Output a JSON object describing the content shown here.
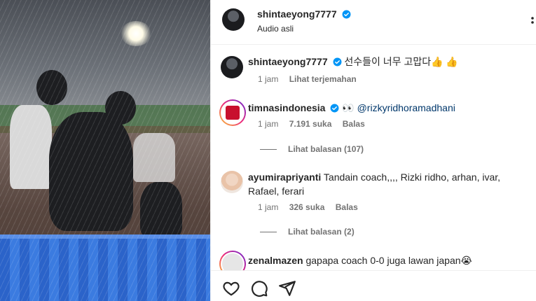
{
  "media": {
    "description_icon": "video-frame"
  },
  "post_header": {
    "username": "shintaeyong7777",
    "audio": "Audio asli"
  },
  "caption": {
    "username": "shintaeyong7777",
    "text": "선수들이 너무 고맙다👍 👍",
    "time": "1 jam",
    "translate": "Lihat terjemahan"
  },
  "comments": [
    {
      "username": "timnasindonesia",
      "verified": true,
      "emoji": "👀",
      "mention": "@rizkyridhoramadhani",
      "time": "1 jam",
      "likes": "7.191 suka",
      "reply": "Balas",
      "view_replies": "Lihat balasan (107)"
    },
    {
      "username": "ayumirapriyanti",
      "text": "Tandain coach,,,, Rizki ridho, arhan, ivar, Rafael, ferari",
      "time": "1 jam",
      "likes": "326 suka",
      "reply": "Balas",
      "view_replies": "Lihat balasan (2)"
    },
    {
      "username": "zenalmazen",
      "text": "gapapa coach 0-0 juga lawan japan😭"
    }
  ],
  "colors": {
    "verified_blue": "#0095f6",
    "mention_blue": "#00376b",
    "muted_text": "#737373"
  },
  "icons": [
    "heart-icon",
    "comment-icon",
    "share-icon",
    "more-options-icon",
    "verified-icon"
  ]
}
